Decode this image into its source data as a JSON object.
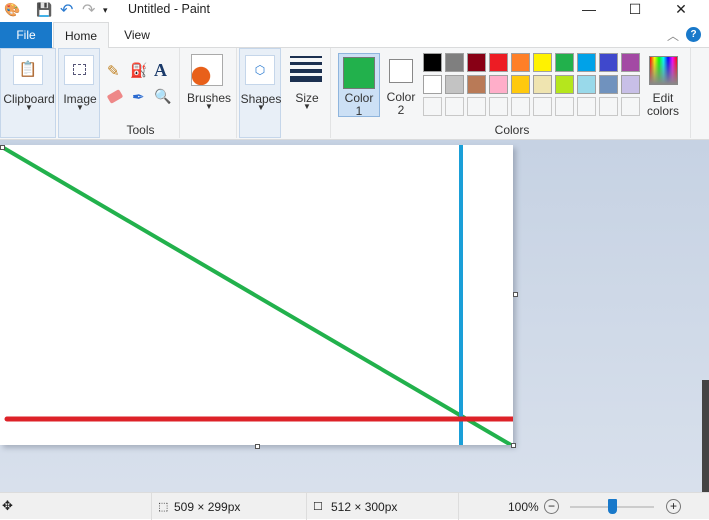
{
  "window": {
    "title": "Untitled - Paint"
  },
  "tabs": [
    "File",
    "Home",
    "View"
  ],
  "ribbon": {
    "clipboard": "Clipboard",
    "image": "Image",
    "tools": "Tools",
    "brushes": "Brushes",
    "shapes": "Shapes",
    "size": "Size",
    "color1": [
      "Color",
      "1"
    ],
    "color2": [
      "Color",
      "2"
    ],
    "edit_colors": [
      "Edit",
      "colors"
    ],
    "colors": "Colors",
    "color1_value": "#22b14c",
    "color2_value": "#ffffff",
    "palette_row1": [
      "#000000",
      "#7f7f7f",
      "#880015",
      "#ed1c24",
      "#ff7f27",
      "#fff200",
      "#22b14c",
      "#00a2e8",
      "#3f48cc",
      "#a349a4"
    ],
    "palette_row2": [
      "#ffffff",
      "#c3c3c3",
      "#b97a57",
      "#ffaec9",
      "#ffc90e",
      "#efe4b0",
      "#b5e61d",
      "#99d9ea",
      "#7092be",
      "#c8bfe7"
    ]
  },
  "status": {
    "selection_size": "509 × 299px",
    "canvas_size": "512 × 300px",
    "zoom": "100%",
    "zoom_level": 0.5
  }
}
